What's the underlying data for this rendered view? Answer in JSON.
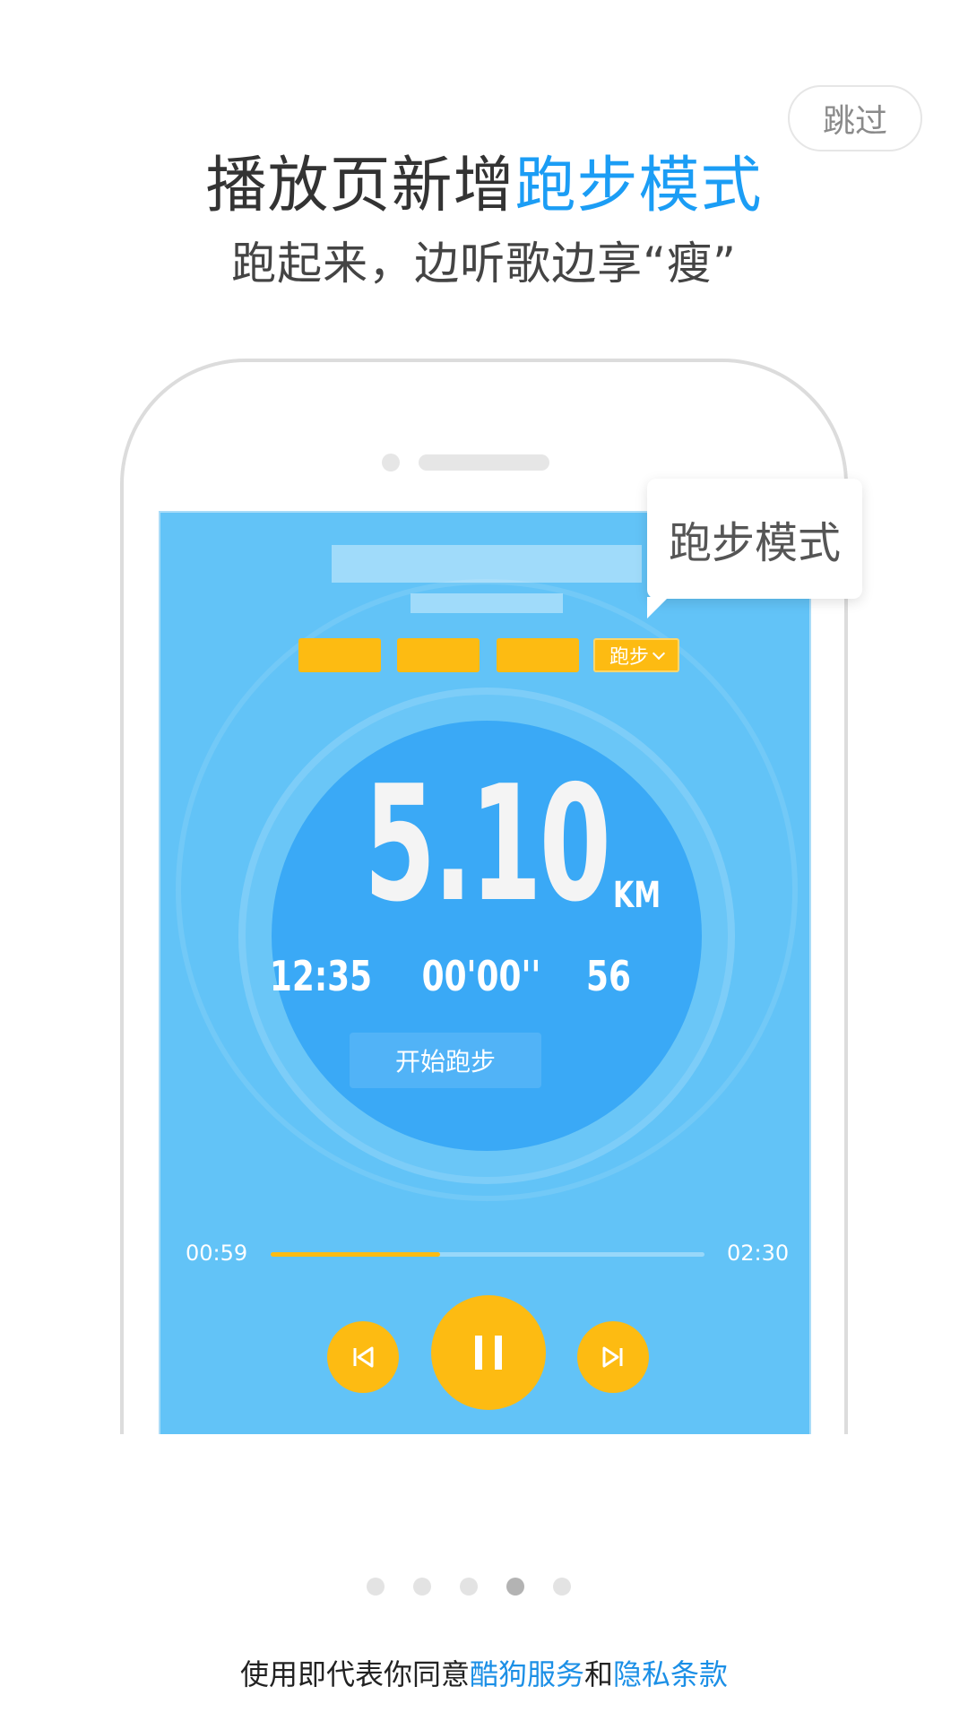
{
  "header": {
    "skip_label": "跳过",
    "title_prefix": "播放页新增",
    "title_highlight": "跑步模式",
    "subtitle": "跑起来，边听歌边享“瘦”"
  },
  "tooltip": {
    "label": "跑步模式"
  },
  "player": {
    "mode_tag": "跑步",
    "distance": "5.10",
    "distance_unit": "KM",
    "stats": [
      "12:35",
      "00'00''",
      "56"
    ],
    "start_button": "开始跑步",
    "elapsed": "00:59",
    "duration": "02:30",
    "progress": 0.39
  },
  "pager": {
    "count": 5,
    "active_index": 3
  },
  "footer": {
    "prefix": "使用即代表你同意",
    "link_service": "酷狗服务",
    "joiner": "和",
    "link_privacy": "隐私条款"
  },
  "colors": {
    "accent_blue": "#1b9df5",
    "screen_blue": "#62c3f7",
    "circle_blue": "#3aa9f6",
    "button_yellow": "#fdbb12"
  },
  "icons": {
    "prev": "skip-previous-icon",
    "pause": "pause-icon",
    "next": "skip-next-icon",
    "dropdown": "chevron-down-icon"
  }
}
